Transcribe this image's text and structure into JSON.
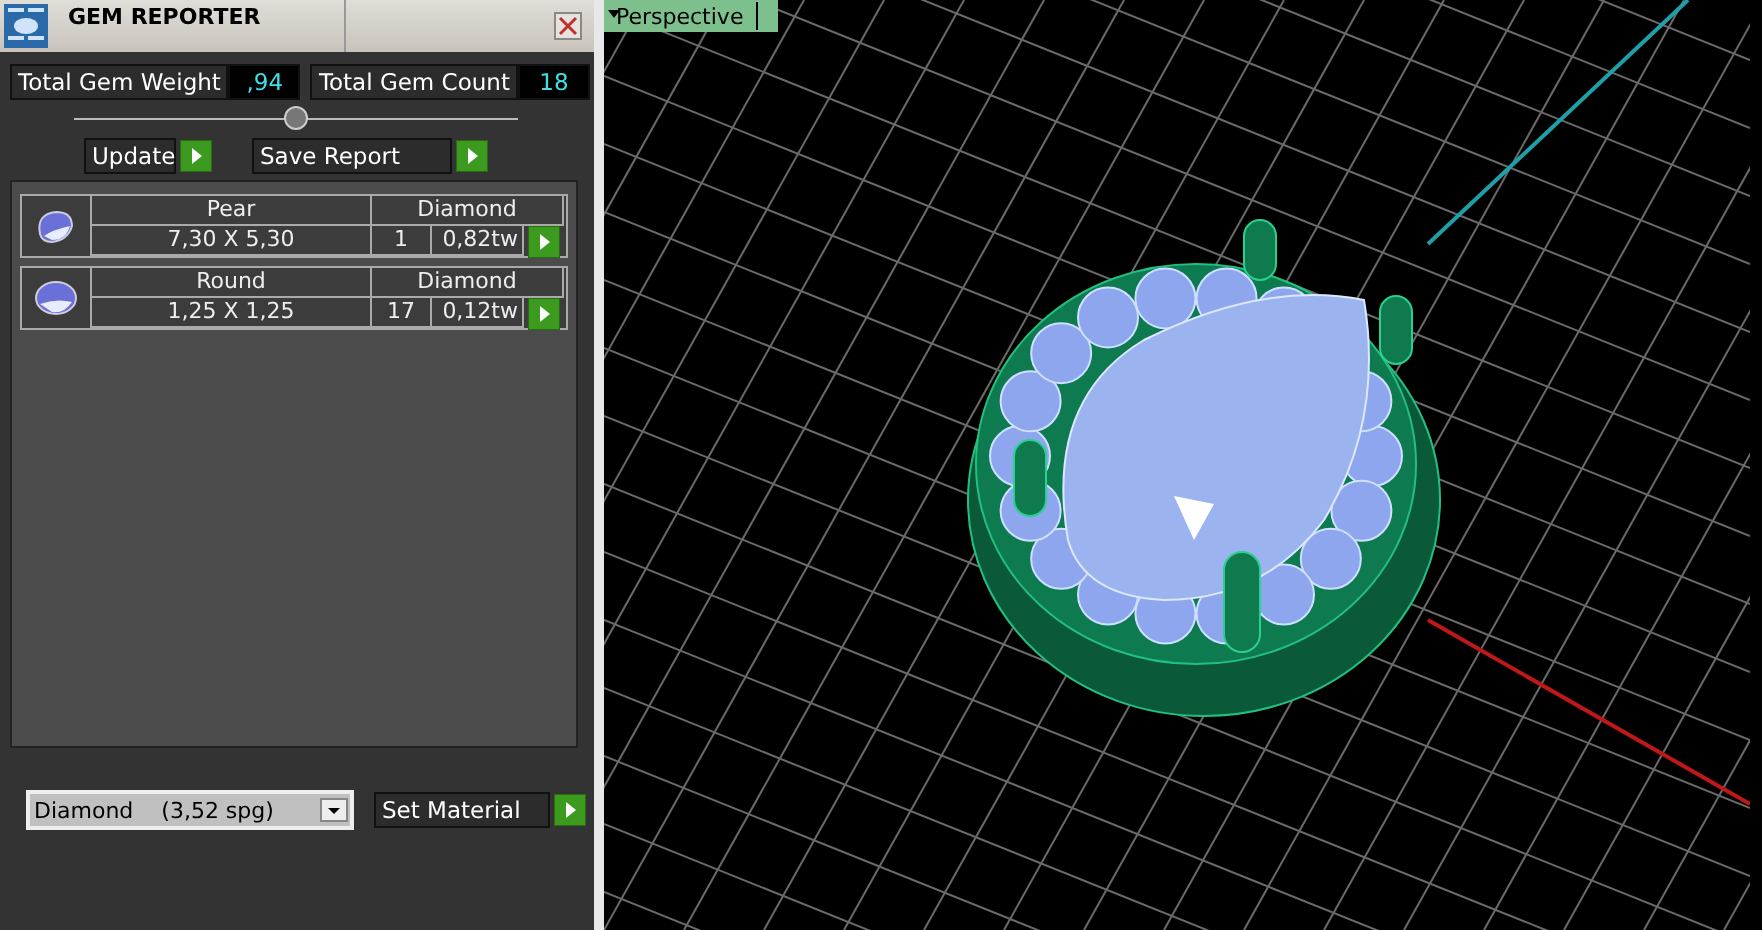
{
  "window": {
    "title": "GEM REPORTER"
  },
  "totals": [
    {
      "label": "Total Gem Weight",
      "value": ",94"
    },
    {
      "label": "Total Gem Count",
      "value": "18"
    }
  ],
  "slider": {
    "level": 0.5
  },
  "actions": [
    {
      "label": "Update"
    },
    {
      "label": "Save Report"
    }
  ],
  "gems": [
    {
      "kind": "pear",
      "shape": "Pear",
      "material": "Diamond",
      "size": "7,30 X 5,30",
      "count": "1",
      "weight": "0,82tw"
    },
    {
      "kind": "round",
      "shape": "Round",
      "material": "Diamond",
      "size": "1,25 X 1,25",
      "count": "17",
      "weight": "0,12tw"
    }
  ],
  "material_select": {
    "value": "Diamond    (3,52 spg)"
  },
  "set_material_button": "Set Material",
  "viewport": {
    "view_menu": "Perspective"
  }
}
